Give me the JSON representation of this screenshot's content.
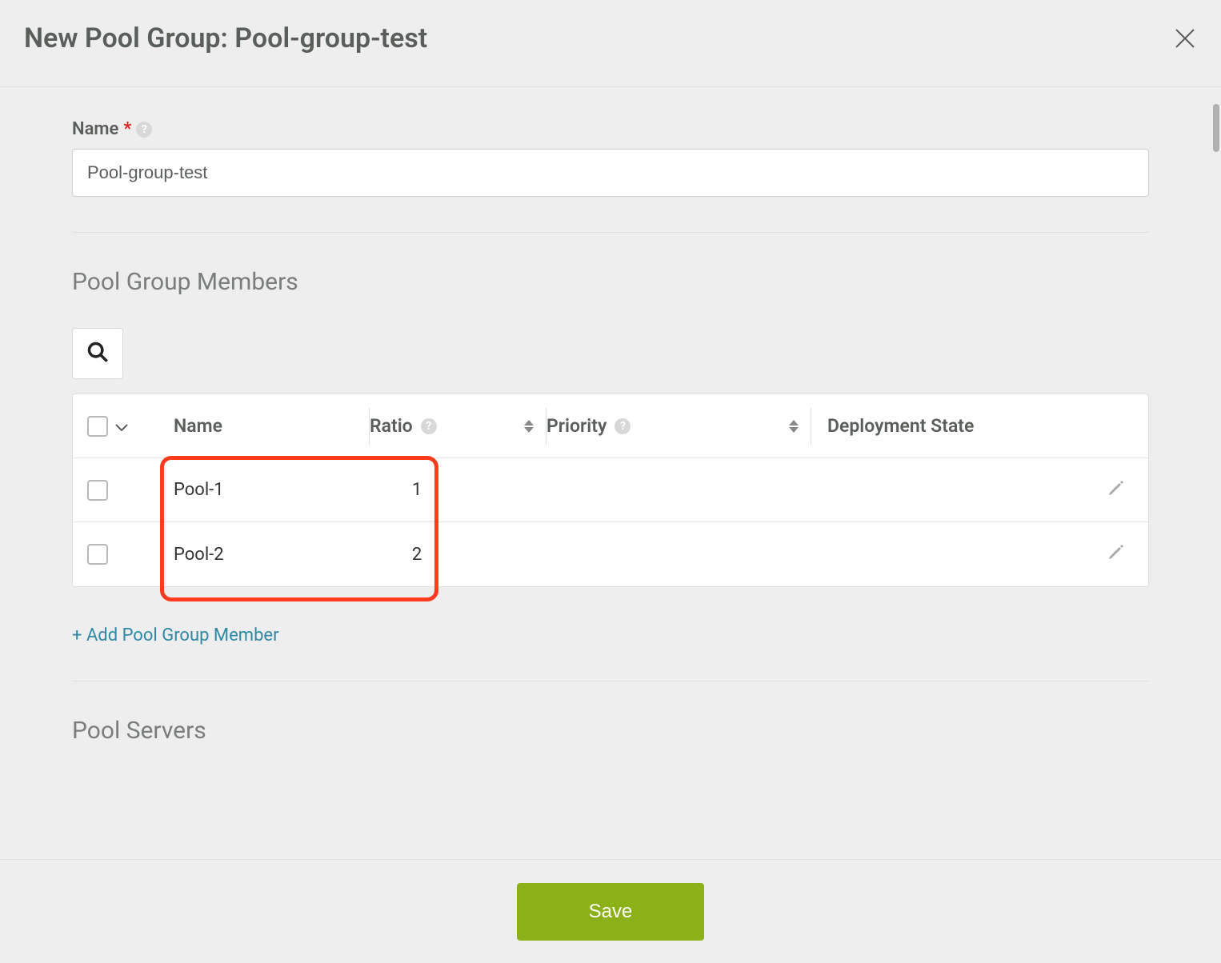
{
  "header": {
    "title": "New Pool Group: Pool-group-test"
  },
  "name_field": {
    "label": "Name",
    "value": "Pool-group-test"
  },
  "sections": {
    "members_title": "Pool Group Members",
    "servers_title": "Pool Servers"
  },
  "table": {
    "columns": {
      "name": "Name",
      "ratio": "Ratio",
      "priority": "Priority",
      "deployment_state": "Deployment State"
    },
    "rows": [
      {
        "name": "Pool-1",
        "ratio": "1",
        "priority": "",
        "deployment_state": ""
      },
      {
        "name": "Pool-2",
        "ratio": "2",
        "priority": "",
        "deployment_state": ""
      }
    ]
  },
  "actions": {
    "add_member": "+ Add Pool Group Member",
    "save": "Save"
  }
}
